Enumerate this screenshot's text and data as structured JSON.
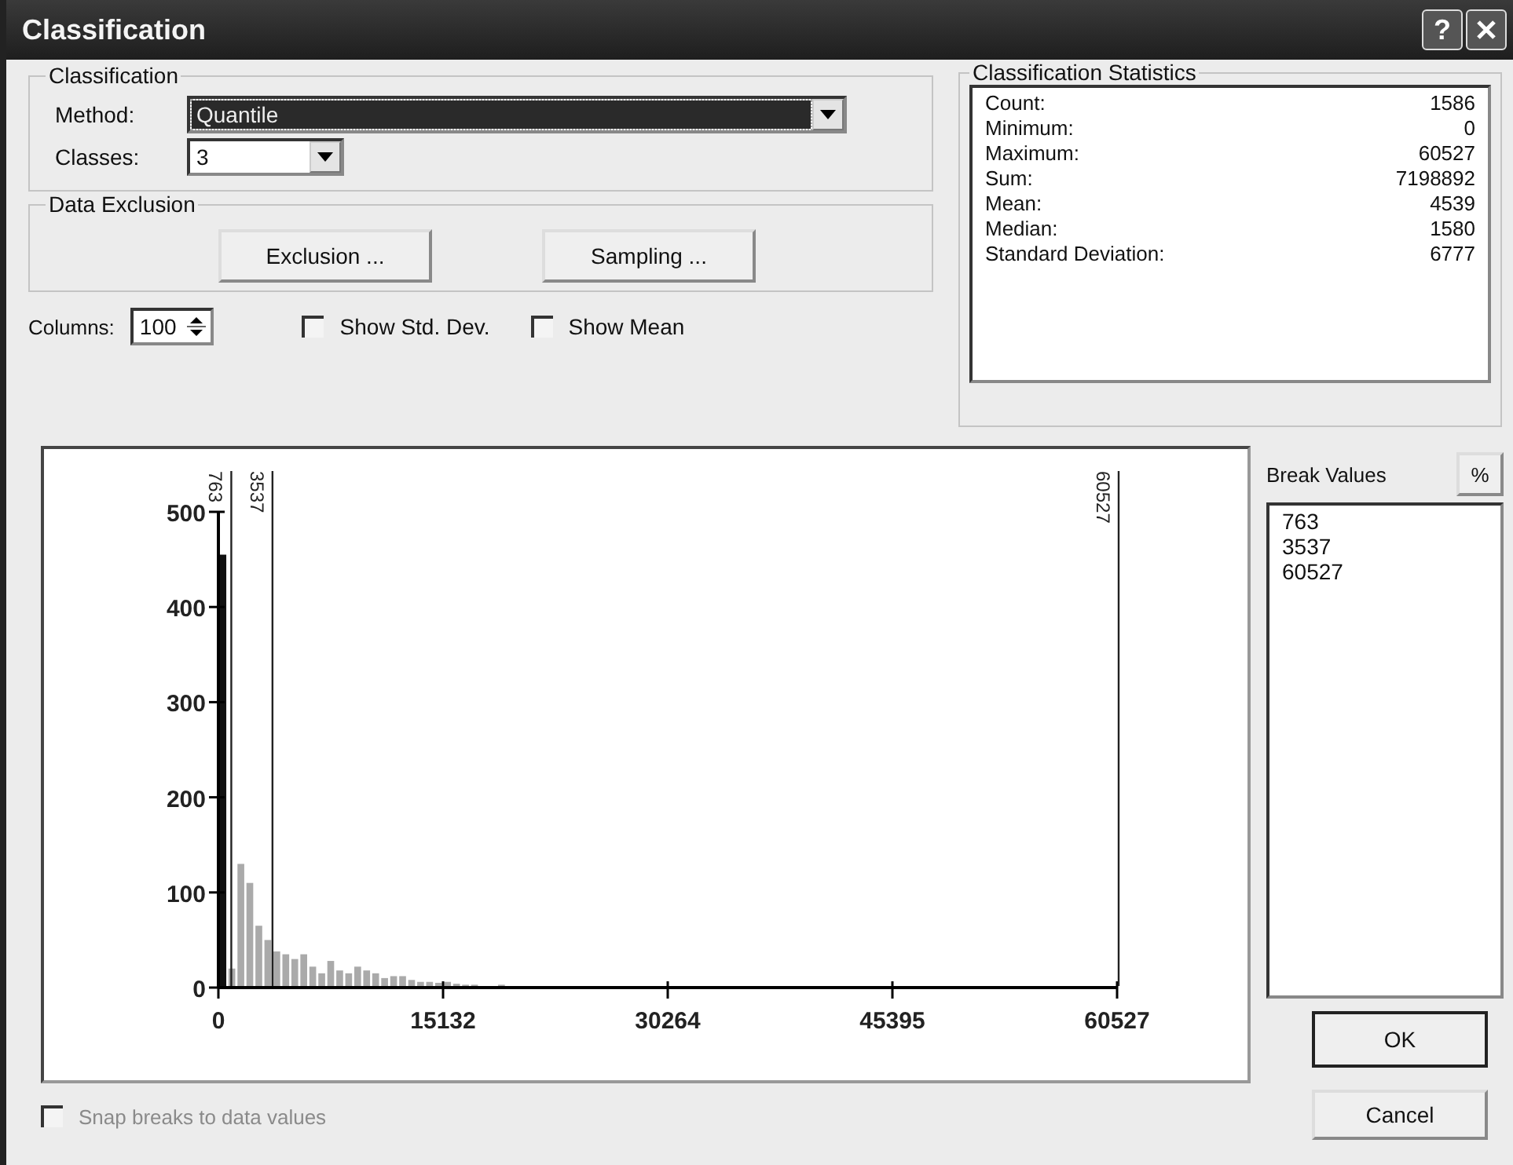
{
  "window": {
    "title": "Classification"
  },
  "title_buttons": [
    {
      "kind": "help",
      "label": "?"
    },
    {
      "kind": "close"
    }
  ],
  "classification": {
    "title": "Classification",
    "method_label": "Method:",
    "method": {
      "value": "Quantile",
      "focused": true
    },
    "classes_label": "Classes:",
    "classes": "3"
  },
  "data_exclusion": {
    "title": "Data Exclusion",
    "buttons": [
      "Exclusion ...",
      "Sampling ..."
    ]
  },
  "columns": {
    "label": "Columns:",
    "value": "100"
  },
  "checkboxes": [
    {
      "label": "Show Std. Dev.",
      "checked": false
    },
    {
      "label": "Show Mean",
      "checked": false
    }
  ],
  "statistics": {
    "title": "Classification Statistics",
    "rows": [
      {
        "label": "Count:",
        "value": "1586"
      },
      {
        "label": "Minimum:",
        "value": "0"
      },
      {
        "label": "Maximum:",
        "value": "60527"
      },
      {
        "label": "Sum:",
        "value": "7198892"
      },
      {
        "label": "Mean:",
        "value": "4539"
      },
      {
        "label": "Median:",
        "value": "1580"
      },
      {
        "label": "Standard Deviation:",
        "value": "6777"
      }
    ]
  },
  "histogram": {
    "chart_data": {
      "type": "bar",
      "xlim": [
        0,
        60527
      ],
      "ylim": [
        0,
        500
      ],
      "xticks": [
        0,
        15132,
        30264,
        45395,
        60527
      ],
      "yticks": [
        0,
        100,
        200,
        300,
        400,
        500
      ],
      "x": [
        303,
        908,
        1513,
        2118,
        2724,
        3329,
        3934,
        4540,
        5145,
        5750,
        6355,
        6961,
        7566,
        8171,
        8776,
        9382,
        9987,
        10592,
        11197,
        11803,
        12408,
        13013,
        13618,
        14224,
        14829,
        15434,
        16040,
        16645,
        17250,
        19066
      ],
      "values": [
        455,
        20,
        130,
        110,
        65,
        50,
        38,
        35,
        30,
        35,
        22,
        15,
        28,
        18,
        15,
        22,
        18,
        15,
        10,
        12,
        12,
        8,
        6,
        6,
        5,
        6,
        4,
        3,
        3,
        3
      ],
      "ref_lines": [
        {
          "axis": "x",
          "value": 763,
          "label": "763"
        },
        {
          "axis": "x",
          "value": 3537,
          "label": "3537"
        },
        {
          "axis": "x",
          "value": 60527,
          "label": "60527"
        }
      ]
    }
  },
  "break_values": {
    "title": "Break Values",
    "percent_button": "%",
    "values": [
      "763",
      "3537",
      "60527"
    ]
  },
  "snap_checkbox": {
    "label": "Snap breaks to data values",
    "checked": false,
    "disabled": true
  },
  "buttons": [
    {
      "label": "OK",
      "default": true
    },
    {
      "label": "Cancel",
      "default": false
    }
  ]
}
